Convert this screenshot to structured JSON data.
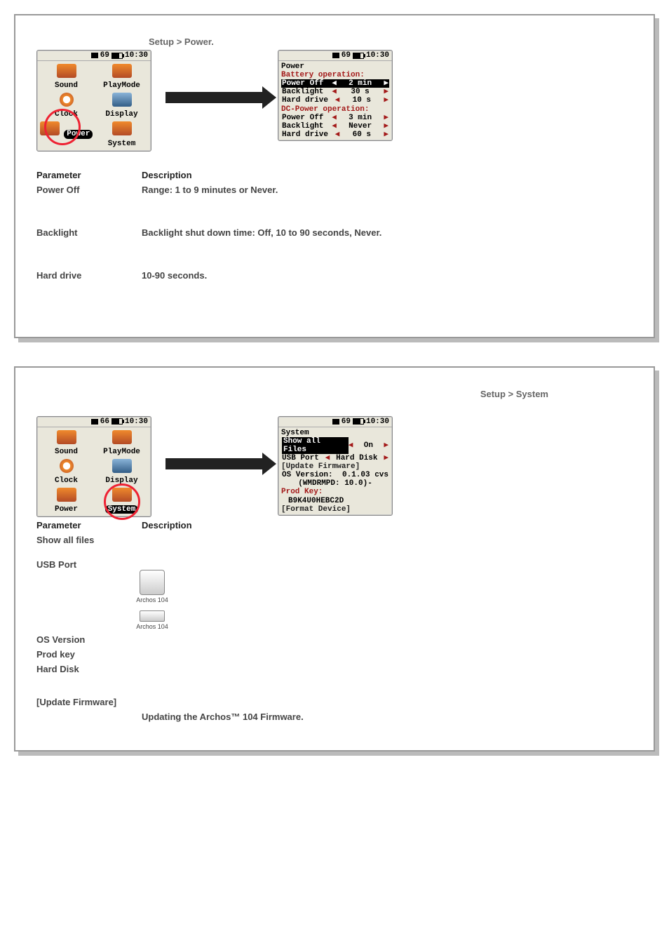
{
  "card1": {
    "breadcrumb": "Setup > Power.",
    "statusbar": {
      "level": "69",
      "time": "10:30"
    },
    "menu": {
      "items": [
        {
          "name": "sound",
          "label": "Sound"
        },
        {
          "name": "playmode",
          "label": "PlayMode"
        },
        {
          "name": "clock",
          "label": "Clock"
        },
        {
          "name": "display",
          "label": "Display"
        },
        {
          "name": "power",
          "label": "Power"
        },
        {
          "name": "system",
          "label": "System"
        }
      ],
      "highlighted": "Power"
    },
    "detail": {
      "title": "Power",
      "section1": "Battery operation:",
      "rows1": [
        {
          "label": "Power Off",
          "value": "2 min",
          "selected": true
        },
        {
          "label": "Backlight",
          "value": "30 s"
        },
        {
          "label": "Hard drive",
          "value": "10 s"
        }
      ],
      "section2": "DC-Power operation:",
      "rows2": [
        {
          "label": "Power Off",
          "value": "3 min"
        },
        {
          "label": "Backlight",
          "value": "Never"
        },
        {
          "label": "Hard drive",
          "value": "60 s"
        }
      ]
    },
    "table": {
      "hdrParam": "Parameter",
      "hdrDesc": "Description",
      "rows": [
        {
          "param": "Power Off",
          "desc": "Range: 1 to 9 minutes or Never."
        },
        {
          "param": "Backlight",
          "desc": "Backlight shut down time: Off, 10 to 90 seconds, Never."
        },
        {
          "param": "Hard drive",
          "desc": "10-90 seconds."
        }
      ]
    }
  },
  "card2": {
    "breadcrumb": "Setup > System",
    "statusbar1": {
      "level": "66",
      "time": "10:30"
    },
    "statusbar2": {
      "level": "69",
      "time": "10:30"
    },
    "menu": {
      "items": [
        {
          "name": "sound",
          "label": "Sound"
        },
        {
          "name": "playmode",
          "label": "PlayMode"
        },
        {
          "name": "clock",
          "label": "Clock"
        },
        {
          "name": "display",
          "label": "Display"
        },
        {
          "name": "power",
          "label": "Power"
        },
        {
          "name": "system",
          "label": "System"
        }
      ],
      "highlighted": "System"
    },
    "detail": {
      "title": "System",
      "rows": [
        {
          "label": "Show all Files",
          "value": "On",
          "selected": true
        },
        {
          "label": "USB Port",
          "value": "Hard Disk"
        }
      ],
      "updateFw": "[Update Firmware]",
      "osVersionLabel": "OS Version:",
      "osVersionValue": "0.1.03 cvs",
      "wmdrm": "(WMDRMPD: 10.0)-",
      "prodKeyLabel": "Prod Key:",
      "prodKeyValue": "B9K4U0HEBC2D",
      "format": "[Format Device]"
    },
    "thumbLabel": "Archos 104",
    "table": {
      "hdrParam": "Parameter",
      "hdrDesc": "Description",
      "rows": [
        {
          "param": "Show all files",
          "desc": ""
        },
        {
          "param": "USB Port",
          "desc": ""
        },
        {
          "param": "OS Version",
          "desc": ""
        },
        {
          "param": "Prod key",
          "desc": ""
        },
        {
          "param": "Hard Disk",
          "desc": ""
        },
        {
          "param": "[Update Firmware]",
          "desc": ""
        }
      ],
      "footText": "Updating the Archos™ 104 Firmware."
    }
  }
}
